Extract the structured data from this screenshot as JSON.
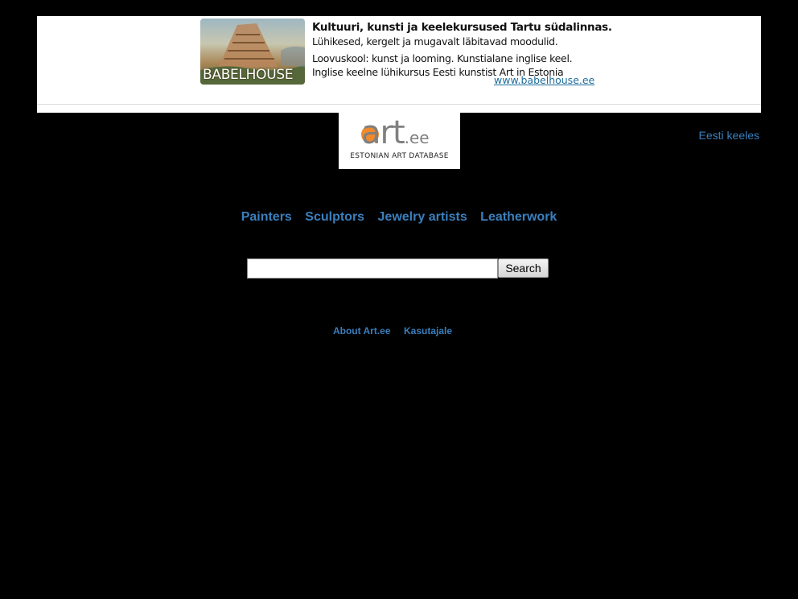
{
  "banner": {
    "image_label": "BABELHOUSE",
    "headline": "Kultuuri, kunsti ja keelekursused Tartu südalinnas.",
    "lines": [
      "Lühikesed, kergelt ja mugavalt läbitavad moodulid.",
      "Loovuskool: kunst ja looming.  Kunstialane inglise keel.",
      "Inglise keelne lühikursus Eesti kunstist Art in Estonia"
    ],
    "url": "www.babelhouse.ee"
  },
  "logo": {
    "mark": "art",
    "suffix": ".ee",
    "tagline": "ESTONIAN ART DATABASE",
    "accent": "#f08a2c"
  },
  "language_link": "Eesti keeles",
  "nav": {
    "items": [
      "Painters",
      "Sculptors",
      "Jewelry artists",
      "Leatherwork"
    ]
  },
  "search": {
    "value": "",
    "placeholder": "",
    "button_label": "Search"
  },
  "footer": {
    "links": [
      "About Art.ee",
      "Kasutajale"
    ]
  },
  "colors": {
    "background": "#000000",
    "link": "#3a7fbd",
    "ad_link": "#1d6d9c"
  }
}
